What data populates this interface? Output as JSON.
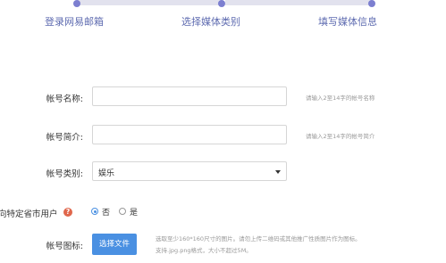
{
  "stepper": {
    "steps": [
      {
        "label": "登录网易邮箱"
      },
      {
        "label": "选择媒体类别"
      },
      {
        "label": "填写媒体信息"
      }
    ]
  },
  "form": {
    "name": {
      "label": "帐号名称:",
      "value": "",
      "hint": "请输入2至14字的帐号名称"
    },
    "intro": {
      "label": "帐号简介:",
      "value": "",
      "hint": "请输入2至14字的帐号简介"
    },
    "category": {
      "label": "帐号类别:",
      "selected": "娱乐"
    },
    "region": {
      "label": "向特定省市用户",
      "help": "?",
      "options": [
        {
          "label": "否",
          "checked": true
        },
        {
          "label": "是",
          "checked": false
        }
      ]
    },
    "icon": {
      "label": "帐号图标:",
      "button": "选择文件",
      "desc_line1": "选取至少160*160尺寸的图片。请勿上传二维码或其他推广性质图片作为图标。",
      "desc_line2": "支持.jpg.png格式，大小不超过5M。"
    }
  },
  "colors": {
    "accent": "#4a90e2",
    "step_dot": "#7c7fd0",
    "step_line": "#e2e2ee",
    "help_icon": "#e0674c"
  }
}
